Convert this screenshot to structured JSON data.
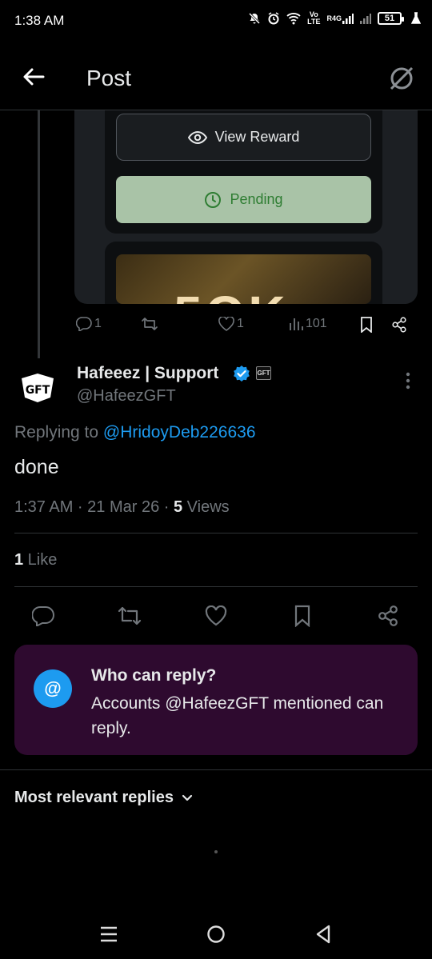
{
  "status_bar": {
    "time": "1:38 AM",
    "net_top": "Vo",
    "net_bottom": "LTE",
    "net_label": "R4G",
    "battery": "51"
  },
  "header": {
    "title": "Post",
    "back_icon": "back-arrow-icon",
    "grok_icon": "grok-icon"
  },
  "parent_post": {
    "media": {
      "view_reward_label": "View Reward",
      "pending_label": "Pending",
      "partial_text": "5OK"
    },
    "actions": {
      "reply_count": "1",
      "repost_count": "",
      "like_count": "1",
      "view_count": "101"
    }
  },
  "reply_post": {
    "display_name": "Hafeeez | Support",
    "handle": "@HafeezGFT",
    "affiliate_badge": "GFT",
    "replying_prefix": "Replying to",
    "replying_to": "@HridoyDeb226636",
    "text": "done",
    "time_date": "1:37 AM · 21 Mar 26 · ",
    "views_count": "5",
    "views_label": " Views",
    "likes_count": "1",
    "likes_label": " Like"
  },
  "who_can_reply": {
    "icon": "@",
    "title": "Who can reply?",
    "description": "Accounts @HafeezGFT mentioned can reply."
  },
  "replies_sort": {
    "label": "Most relevant replies"
  },
  "colors": {
    "accent": "#1d9bf0",
    "muted": "#71767b",
    "who_bg": "#2e0a2f",
    "pending_bg": "#a9c3a7",
    "pending_fg": "#2e7d32"
  }
}
